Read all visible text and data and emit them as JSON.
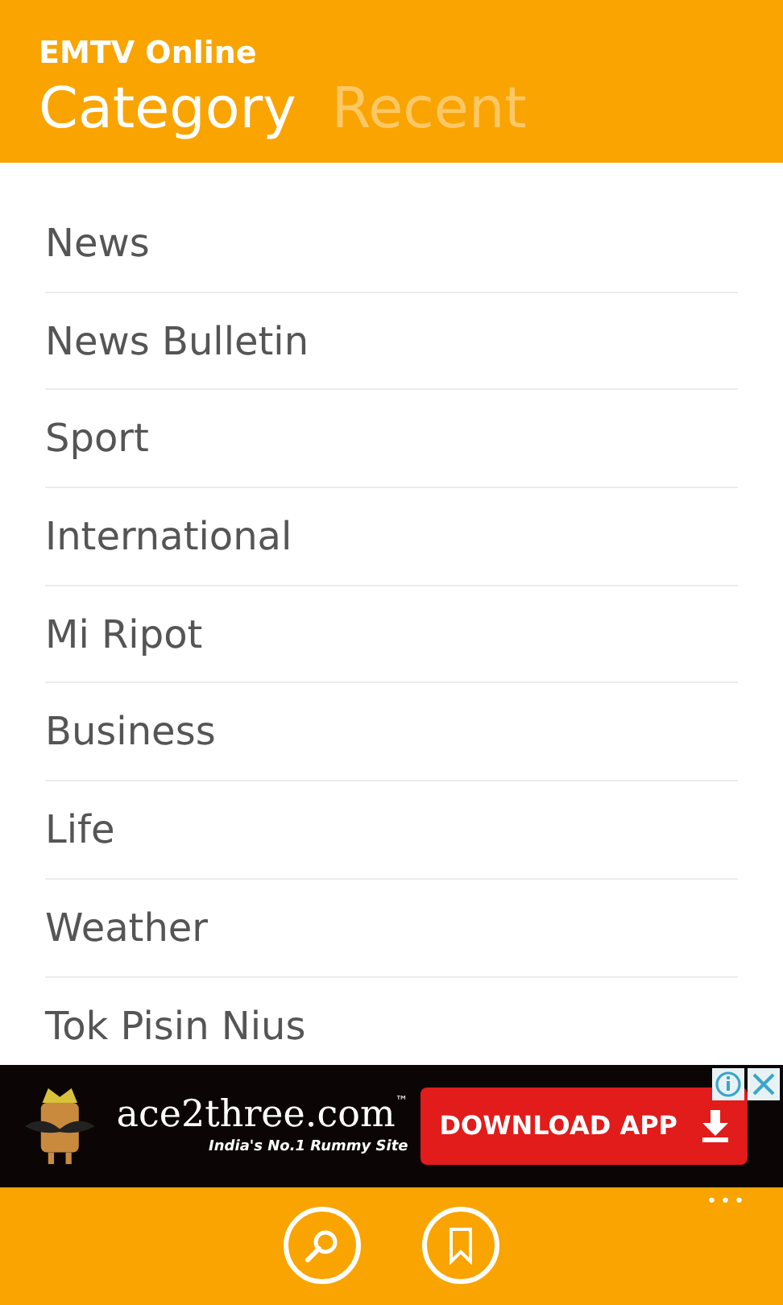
{
  "app_title": "EMTV Online",
  "tabs": [
    {
      "label": "Category",
      "selected": true
    },
    {
      "label": "Recent",
      "selected": false
    }
  ],
  "categories": [
    "News",
    "News Bulletin",
    "Sport",
    "International",
    "Mi Ripot",
    "Business",
    "Life",
    "Weather",
    "Tok Pisin Nius"
  ],
  "ad": {
    "brand": "ace2three.com",
    "trademark": "™",
    "tagline": "India's No.1 Rummy Site",
    "button": "DOWNLOAD APP"
  },
  "app_bar": {
    "more": "•••"
  }
}
